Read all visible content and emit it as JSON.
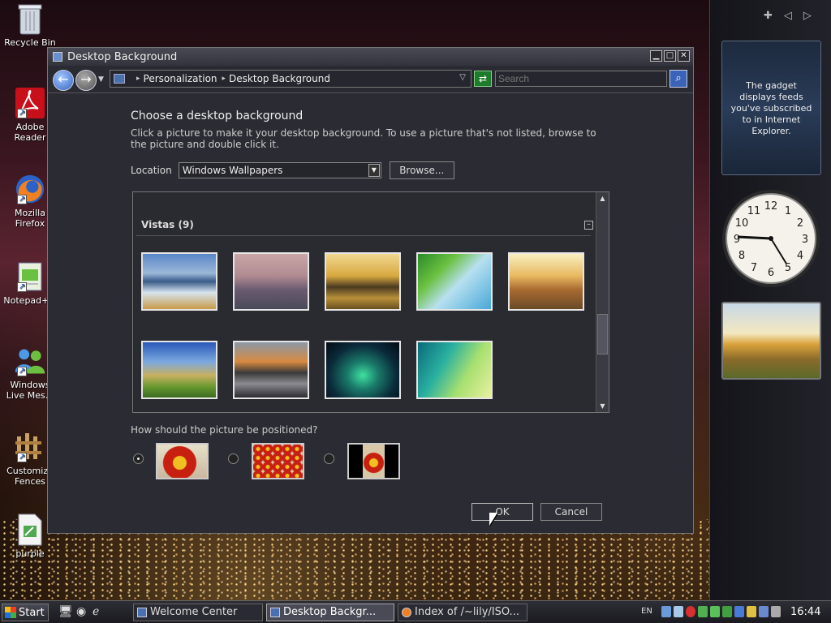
{
  "desktop": {
    "icons": [
      {
        "label": "Recycle Bin",
        "icon": "recycle-bin-icon"
      },
      {
        "label": "Adobe Reader",
        "icon": "adobe-reader-icon"
      },
      {
        "label": "Mozilla Firefox",
        "icon": "firefox-icon"
      },
      {
        "label": "Notepad++",
        "icon": "notepad-icon"
      },
      {
        "label": "Windows Live Mes...",
        "icon": "messenger-icon"
      },
      {
        "label": "Customize Fences",
        "icon": "fences-icon"
      },
      {
        "label": "purple",
        "icon": "purple-file-icon"
      }
    ]
  },
  "sidebar": {
    "feed_text": "The gadget displays feeds you've subscribed to in Internet Explorer.",
    "clock_numbers": [
      "12",
      "1",
      "2",
      "3",
      "4",
      "5",
      "6",
      "7",
      "8",
      "9",
      "10",
      "11"
    ],
    "add_glyph": "✚",
    "prev_glyph": "◁",
    "next_glyph": "▷"
  },
  "window": {
    "title": "Desktop Background",
    "min_glyph": "▁",
    "max_glyph": "□",
    "close_glyph": "✕",
    "breadcrumb": [
      "Personalization",
      "Desktop Background"
    ],
    "search_placeholder": "Search",
    "heading": "Choose a desktop background",
    "description": "Click a picture to make it your desktop background. To use a picture that's not listed, browse to the picture and double click it.",
    "location_label": "Location",
    "location_value": "Windows Wallpapers",
    "browse_label": "Browse...",
    "group_title": "Vistas (9)",
    "collapse_glyph": "–",
    "position_question": "How should the picture be positioned?",
    "ok_label": "OK",
    "cancel_label": "Cancel"
  },
  "taskbar": {
    "start_label": "Start",
    "tasks": [
      {
        "label": "Welcome Center",
        "active": false
      },
      {
        "label": "Desktop Backgr...",
        "active": true
      },
      {
        "label": "Index of /~lily/ISO...",
        "active": false
      }
    ],
    "language": "EN",
    "time": "16:44"
  }
}
